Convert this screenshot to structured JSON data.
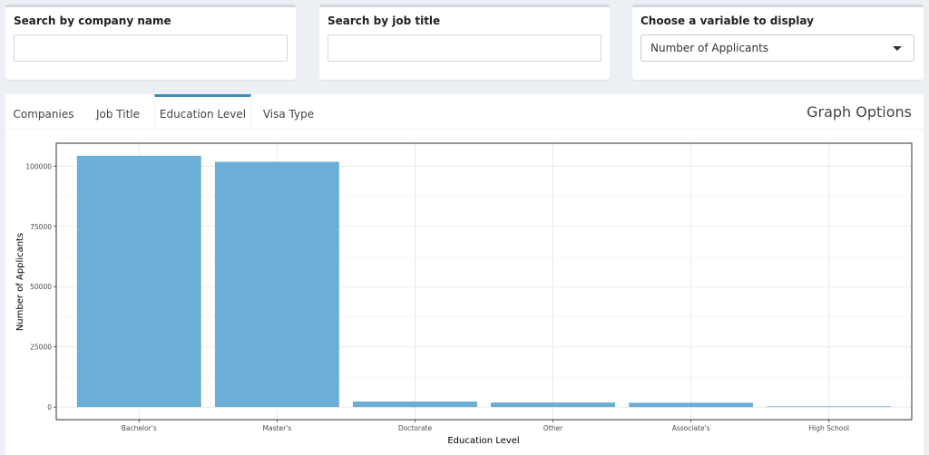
{
  "filters": {
    "company": {
      "label": "Search by company name",
      "value": "",
      "placeholder": ""
    },
    "job_title": {
      "label": "Search by job title",
      "value": "",
      "placeholder": ""
    },
    "variable": {
      "label": "Choose a variable to display",
      "selected": "Number of Applicants"
    }
  },
  "tabs": [
    {
      "label": "Companies",
      "active": false
    },
    {
      "label": "Job Title",
      "active": false
    },
    {
      "label": "Education Level",
      "active": true
    },
    {
      "label": "Visa Type",
      "active": false
    }
  ],
  "graph_options_label": "Graph Options",
  "colors": {
    "accent": "#3c8dbc",
    "bar": "#6baed6"
  },
  "chart_data": {
    "type": "bar",
    "categories": [
      "Bachelor's",
      "Master's",
      "Doctorate",
      "Other",
      "Associate's",
      "High School"
    ],
    "values": [
      104300,
      101800,
      2300,
      1900,
      1800,
      300
    ],
    "title": "",
    "xlabel": "Education Level",
    "ylabel": "Number of Applicants",
    "yticks": [
      0,
      25000,
      50000,
      75000,
      100000
    ],
    "ylim": [
      -5215,
      109515
    ],
    "grid": true,
    "legend": "none"
  }
}
